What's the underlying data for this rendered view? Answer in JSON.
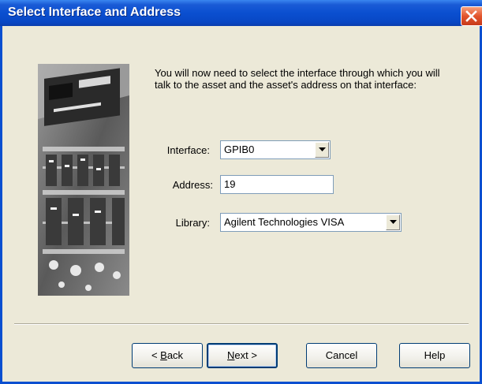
{
  "window": {
    "title": "Select Interface and Address"
  },
  "instructions": "You will now need to select the interface through which you will talk to the asset and the asset's address on that interface:",
  "form": {
    "interface": {
      "label": "Interface:",
      "value": "GPIB0"
    },
    "address": {
      "label": "Address:",
      "value": "19"
    },
    "library": {
      "label": "Library:",
      "value": "Agilent Technologies VISA"
    }
  },
  "buttons": {
    "back": {
      "prefix": "< ",
      "mnemonic": "B",
      "rest": "ack"
    },
    "next": {
      "mnemonic": "N",
      "rest": "ext >"
    },
    "cancel": "Cancel",
    "help": "Help"
  },
  "icons": {
    "close": "close-x-icon",
    "dropdown": "chevron-down-icon",
    "picture": "instrument-rack-photo"
  },
  "colors": {
    "titlebar": "#0a4fd0",
    "dialog_bg": "#ece9d8",
    "close_button": "#e2542c"
  }
}
